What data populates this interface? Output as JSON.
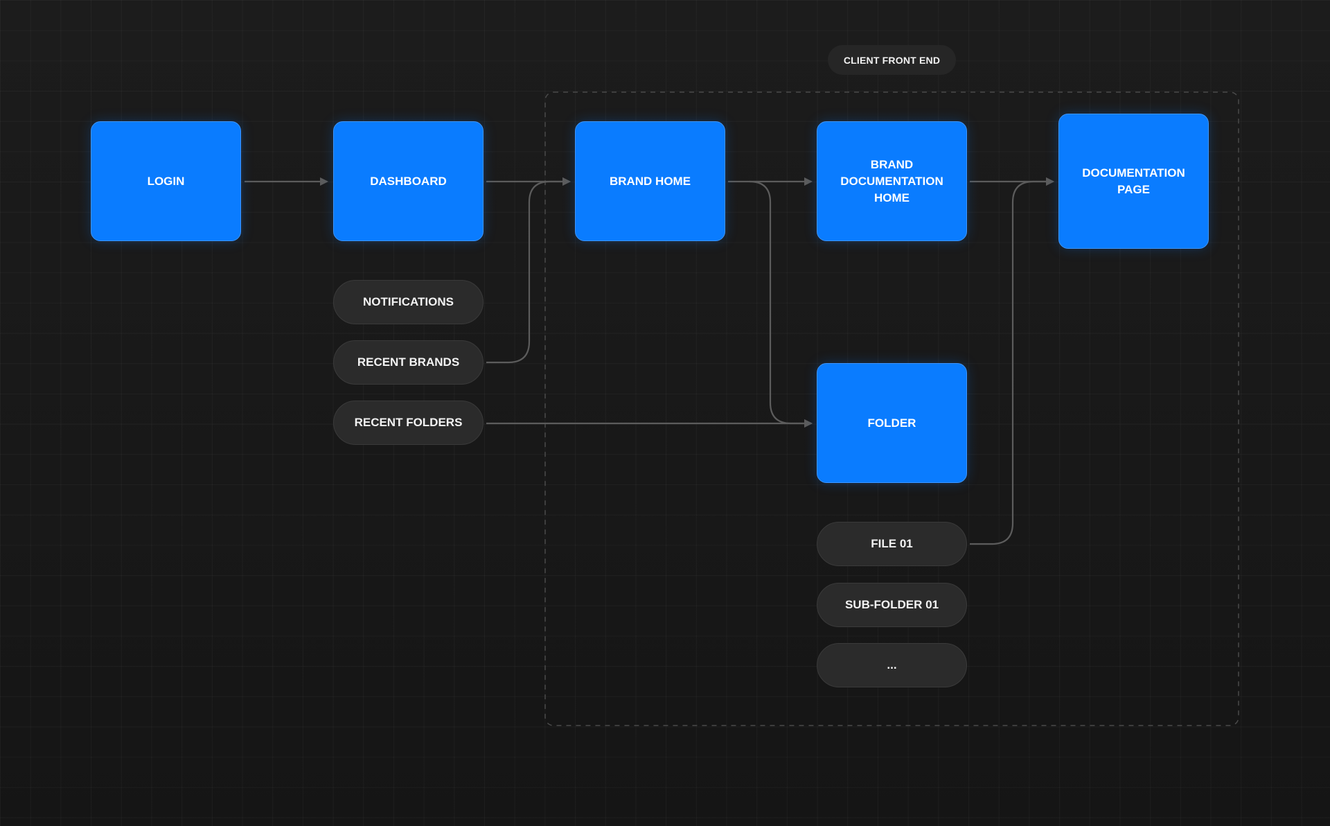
{
  "group": {
    "label": "CLIENT FRONT END"
  },
  "nodes": {
    "login": "LOGIN",
    "dashboard": "DASHBOARD",
    "brand_home": "BRAND HOME",
    "brand_documentation_home": "BRAND\nDOCUMENTATION\nHOME",
    "documentation_page": "DOCUMENTATION\nPAGE",
    "folder": "FOLDER"
  },
  "dashboard_items": [
    {
      "label": "NOTIFICATIONS"
    },
    {
      "label": "RECENT BRANDS"
    },
    {
      "label": "RECENT FOLDERS"
    }
  ],
  "folder_items": [
    {
      "label": "FILE 01"
    },
    {
      "label": "SUB-FOLDER 01"
    },
    {
      "label": "..."
    }
  ],
  "edges": [
    {
      "from": "LOGIN",
      "to": "DASHBOARD"
    },
    {
      "from": "DASHBOARD",
      "to": "BRAND HOME"
    },
    {
      "from": "RECENT BRANDS",
      "to": "BRAND HOME"
    },
    {
      "from": "BRAND HOME",
      "to": "BRAND DOCUMENTATION HOME"
    },
    {
      "from": "BRAND HOME",
      "to": "FOLDER"
    },
    {
      "from": "RECENT FOLDERS",
      "to": "FOLDER"
    },
    {
      "from": "BRAND DOCUMENTATION HOME",
      "to": "DOCUMENTATION PAGE"
    },
    {
      "from": "FILE 01",
      "to": "DOCUMENTATION PAGE"
    }
  ],
  "colors": {
    "node_fill": "#0a7cff",
    "pill_fill": "#2b2b2b",
    "connector": "#5c5c5c",
    "group_border": "#4a4a4a"
  }
}
